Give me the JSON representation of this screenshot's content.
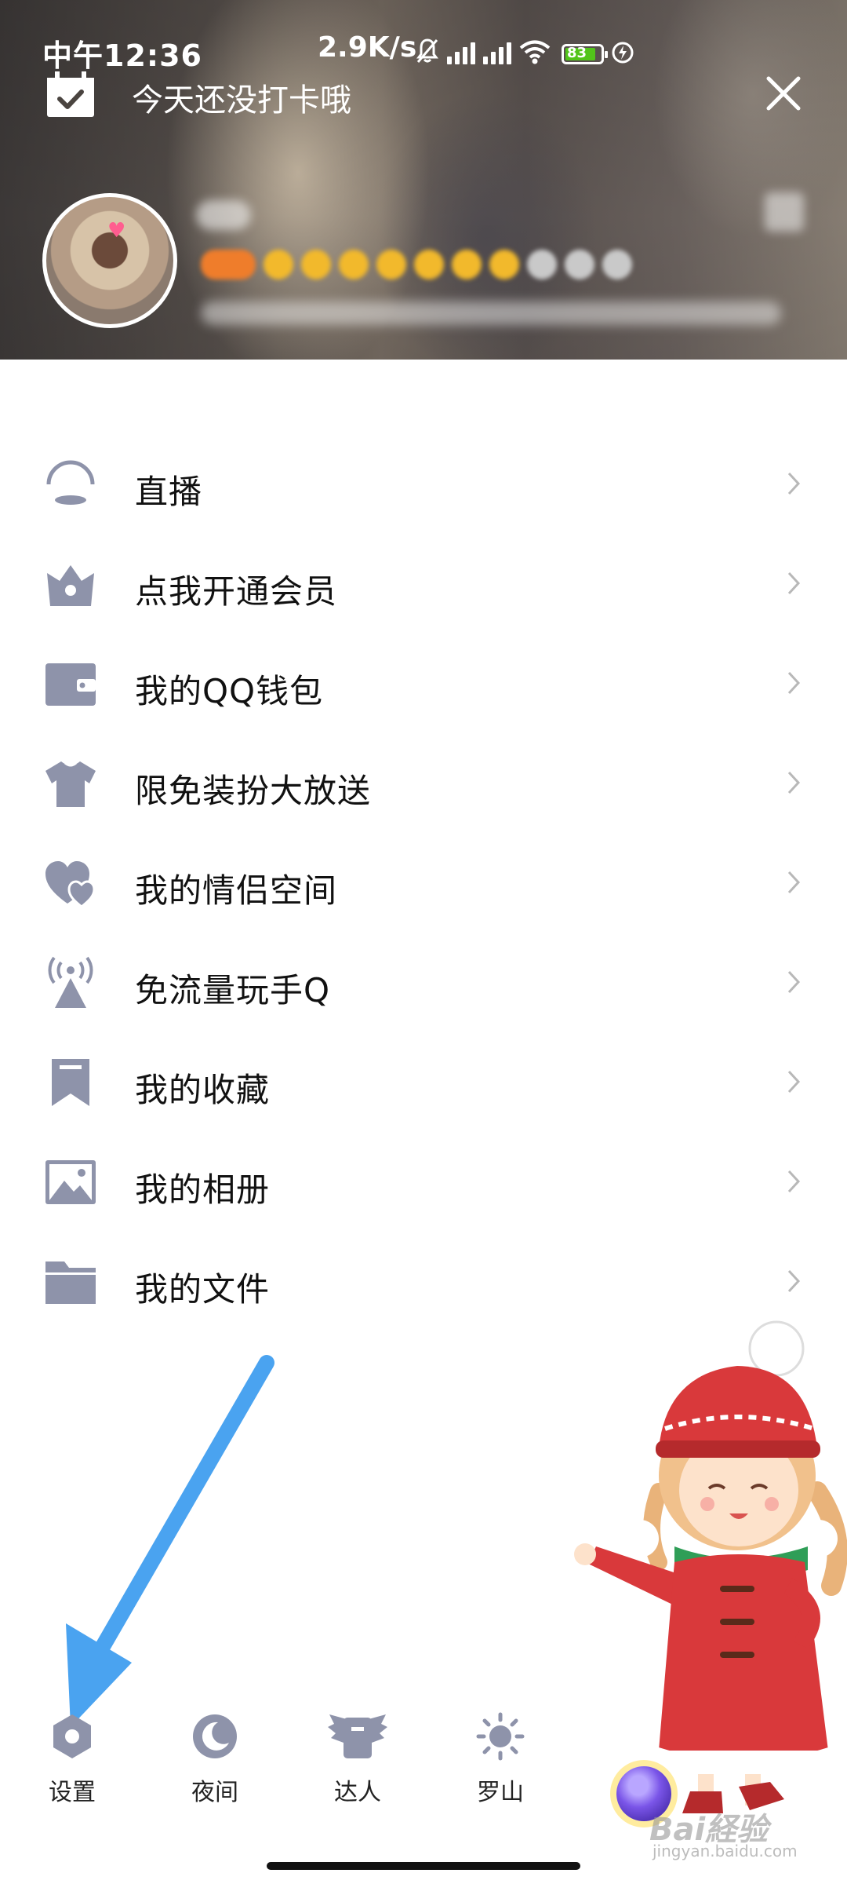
{
  "status_bar": {
    "time": "中午12:36",
    "net_speed": "2.9K/s",
    "battery": "83"
  },
  "header": {
    "checkin_text": "今天还没打卡哦"
  },
  "menu": {
    "items": [
      {
        "label": "直播",
        "icon": "live-icon"
      },
      {
        "label": "点我开通会员",
        "icon": "vip-crown-icon"
      },
      {
        "label": "我的QQ钱包",
        "icon": "wallet-icon"
      },
      {
        "label": "限免装扮大放送",
        "icon": "tshirt-icon"
      },
      {
        "label": "我的情侣空间",
        "icon": "couple-hearts-icon"
      },
      {
        "label": "免流量玩手Q",
        "icon": "antenna-icon"
      },
      {
        "label": "我的收藏",
        "icon": "bookmark-icon"
      },
      {
        "label": "我的相册",
        "icon": "photo-icon"
      },
      {
        "label": "我的文件",
        "icon": "folder-icon"
      }
    ]
  },
  "bottom_bar": {
    "items": [
      {
        "label": "设置",
        "icon": "settings-hex-icon"
      },
      {
        "label": "夜间",
        "icon": "moon-icon"
      },
      {
        "label": "达人",
        "icon": "wings-badge-icon"
      },
      {
        "label": "罗山",
        "icon": "sun-weather-icon"
      }
    ]
  },
  "watermark": {
    "brand": "Bai経验",
    "url": "jingyan.baidu.com"
  },
  "colors": {
    "icon_gray": "#8e93aa",
    "chevron": "#b8b8b8",
    "arrow_blue": "#4aa3f0",
    "battery_green": "#52c41a"
  }
}
